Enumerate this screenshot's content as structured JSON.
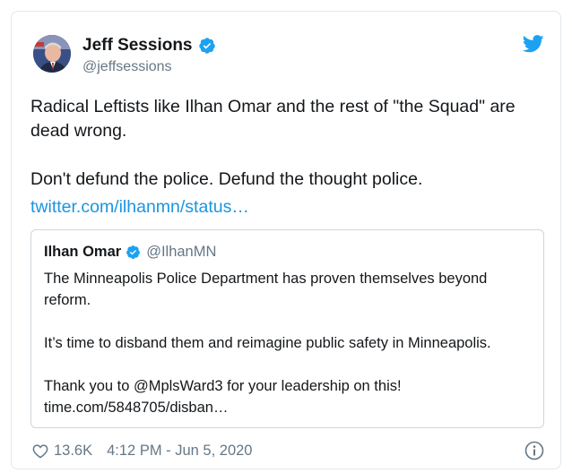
{
  "author": {
    "name": "Jeff Sessions",
    "handle": "@jeffsessions"
  },
  "tweet": {
    "text": "Radical Leftists like Ilhan Omar and the rest of \"the Squad\" are dead wrong.\n\nDon't defund the police. Defund the thought police.",
    "link": "twitter.com/ilhanmn/status…"
  },
  "quoted": {
    "name": "Ilhan Omar",
    "handle": "@IlhanMN",
    "paragraphs": [
      "The Minneapolis Police Department has proven themselves beyond reform.",
      "It’s time to disband them and reimagine public safety in Minneapolis.",
      "Thank you to @MplsWard3 for your leadership on this!\ntime.com/5848705/disban…"
    ]
  },
  "footer": {
    "likes": "13.6K",
    "timestamp": "4:12 PM - Jun 5, 2020"
  },
  "colors": {
    "accent": "#1da1f2",
    "link": "#1b95e0",
    "muted": "#657786",
    "border": "#e1e8ed"
  },
  "icons": [
    "verified-badge-icon",
    "twitter-bird-icon",
    "heart-icon",
    "info-icon"
  ]
}
